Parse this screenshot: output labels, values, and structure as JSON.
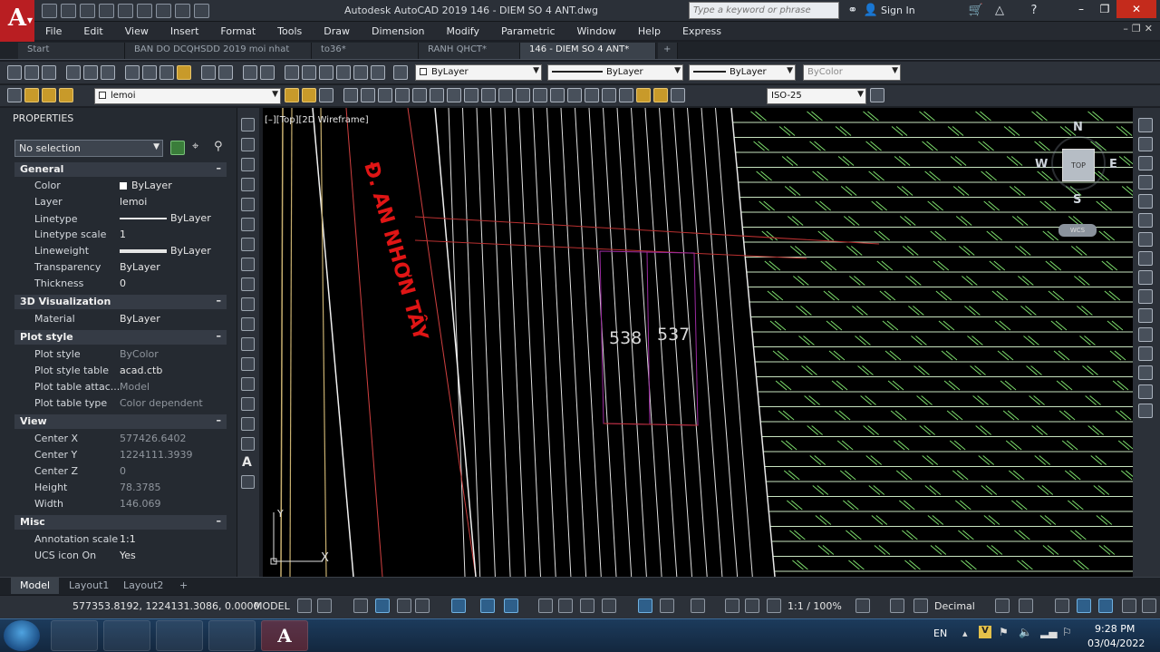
{
  "app": {
    "logo_letter": "A",
    "title": "Autodesk AutoCAD 2019    146 - DIEM SO 4 ANT.dwg",
    "search_placeholder": "Type a keyword or phrase",
    "sign_in": "Sign In"
  },
  "menu": [
    "File",
    "Edit",
    "View",
    "Insert",
    "Format",
    "Tools",
    "Draw",
    "Dimension",
    "Modify",
    "Parametric",
    "Window",
    "Help",
    "Express"
  ],
  "tabs": [
    {
      "label": "Start"
    },
    {
      "label": "BAN DO DCQHSDD 2019 moi nhat"
    },
    {
      "label": "to36*"
    },
    {
      "label": "RANH QHCT*"
    },
    {
      "label": "146 - DIEM SO 4 ANT*"
    },
    {
      "label": "+"
    }
  ],
  "toolbar": {
    "layer_color": "ByLayer",
    "linetype": "ByLayer",
    "lineweight": "ByLayer",
    "plotstyle": "ByColor",
    "current_layer": "lemoi",
    "dimstyle": "ISO-25"
  },
  "properties": {
    "title": "PROPERTIES",
    "selection": "No selection",
    "sections": [
      {
        "name": "General",
        "rows": [
          {
            "label": "Color",
            "value": "ByLayer"
          },
          {
            "label": "Layer",
            "value": "lemoi"
          },
          {
            "label": "Linetype",
            "value": "ByLayer"
          },
          {
            "label": "Linetype scale",
            "value": "1"
          },
          {
            "label": "Lineweight",
            "value": "ByLayer"
          },
          {
            "label": "Transparency",
            "value": "ByLayer"
          },
          {
            "label": "Thickness",
            "value": "0"
          }
        ]
      },
      {
        "name": "3D Visualization",
        "rows": [
          {
            "label": "Material",
            "value": "ByLayer"
          }
        ]
      },
      {
        "name": "Plot style",
        "rows": [
          {
            "label": "Plot style",
            "value": "ByColor"
          },
          {
            "label": "Plot style table",
            "value": "acad.ctb"
          },
          {
            "label": "Plot table attac...",
            "value": "Model"
          },
          {
            "label": "Plot table type",
            "value": "Color dependent"
          }
        ]
      },
      {
        "name": "View",
        "rows": [
          {
            "label": "Center X",
            "value": "577426.6402"
          },
          {
            "label": "Center Y",
            "value": "1224111.3939"
          },
          {
            "label": "Center Z",
            "value": "0"
          },
          {
            "label": "Height",
            "value": "78.3785"
          },
          {
            "label": "Width",
            "value": "146.069"
          }
        ]
      },
      {
        "name": "Misc",
        "rows": [
          {
            "label": "Annotation scale",
            "value": "1:1"
          },
          {
            "label": "UCS icon On",
            "value": "Yes"
          }
        ]
      }
    ]
  },
  "viewport": {
    "label": "[–][Top][2D Wireframe]",
    "road_text": "Đ. AN NHƠN TÂY",
    "parcels": [
      "538",
      "537"
    ],
    "ucs_x": "X",
    "ucs_y": "Y",
    "compass": {
      "n": "N",
      "s": "S",
      "e": "E",
      "w": "W",
      "top": "TOP",
      "wcs": "WCS"
    }
  },
  "layout_tabs": [
    {
      "label": "Model"
    },
    {
      "label": "Layout1"
    },
    {
      "label": "Layout2"
    },
    {
      "label": "+"
    }
  ],
  "status": {
    "coords": "577353.8192, 1224131.3086, 0.0000",
    "model": "MODEL",
    "scale": "1:1 / 100%",
    "units": "Decimal"
  },
  "taskbar": {
    "lang": "EN",
    "time": "9:28 PM",
    "date": "03/04/2022"
  },
  "colors": {
    "road_text": "#e01515",
    "parcel_outline": "#9a2aa0",
    "hatch": "#7ddc6d",
    "accent": "#b91e22"
  }
}
